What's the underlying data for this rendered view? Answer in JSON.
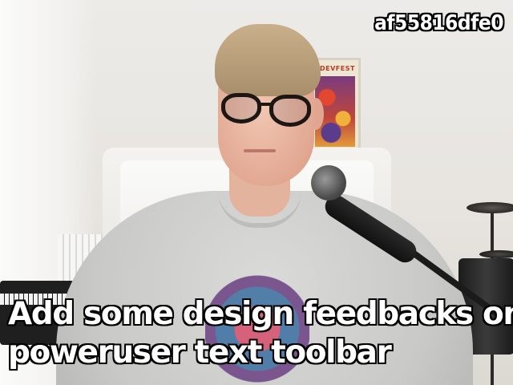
{
  "overlay": {
    "hash_id": "af55816dfe0",
    "caption_lines": [
      "Add some design feedbacks on",
      "poweruser text toolbar"
    ]
  },
  "poster": {
    "title": "DEVFEST"
  },
  "colors": {
    "caption_text": "#ffffff",
    "caption_outline": "#000000",
    "wall": "#e7e4df",
    "shirt": "#c9c9c8"
  }
}
